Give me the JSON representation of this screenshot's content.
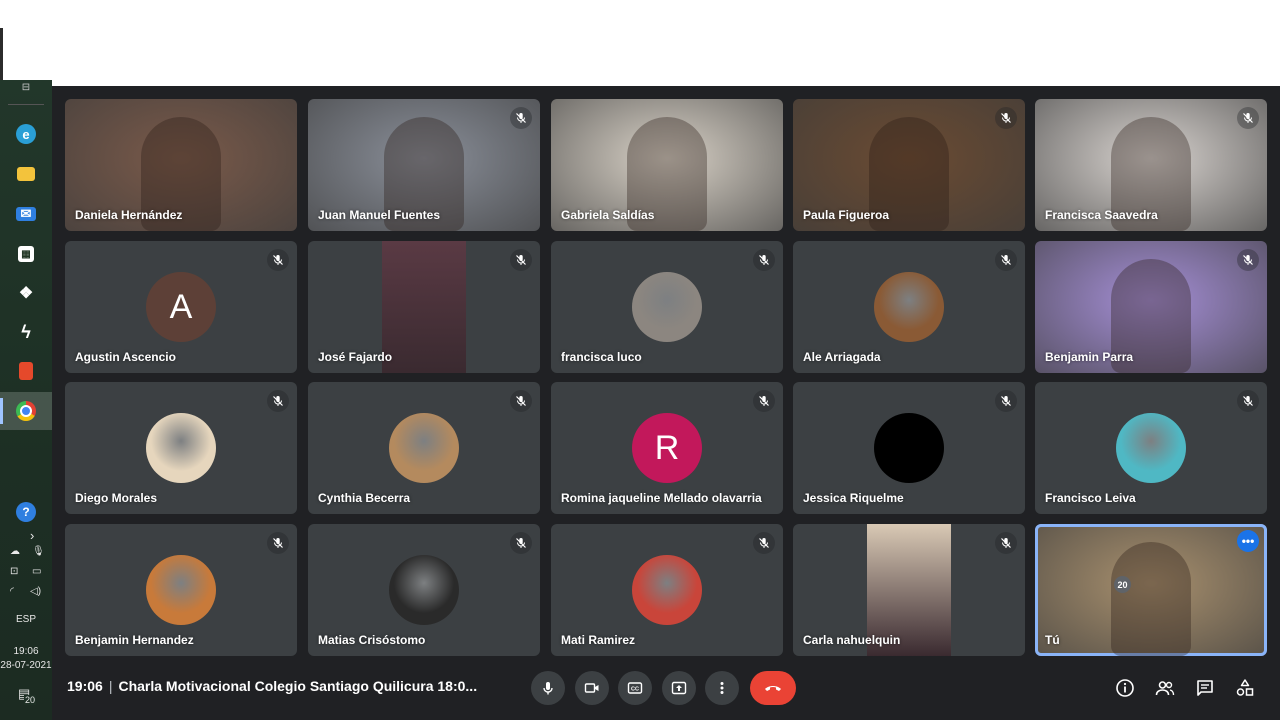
{
  "taskbar": {
    "language": "ESP",
    "time": "19:06",
    "date": "28-07-2021",
    "notifications": "20",
    "apps": [
      {
        "icon": "edge-icon",
        "color": "#2a9fd6"
      },
      {
        "icon": "file-explorer-icon",
        "color": "#f3c33c"
      },
      {
        "icon": "mail-icon",
        "color": "#2f7fe0"
      },
      {
        "icon": "store-icon",
        "color": "#ffffff"
      },
      {
        "icon": "dropbox-icon",
        "color": "#ffffff"
      },
      {
        "icon": "app-icon",
        "color": "#ffffff"
      },
      {
        "icon": "office-icon",
        "color": "#e5492b"
      },
      {
        "icon": "chrome-icon",
        "color": "#e34133"
      }
    ]
  },
  "participants": [
    {
      "name": "Daniela Hernández",
      "muted": false,
      "type": "video",
      "bg": "#7a5a4a"
    },
    {
      "name": "Juan Manuel Fuentes",
      "muted": true,
      "type": "video",
      "bg": "#8a8f99"
    },
    {
      "name": "Gabriela Saldías",
      "muted": false,
      "type": "video",
      "bg": "#d9d2c7"
    },
    {
      "name": "Paula Figueroa",
      "muted": true,
      "type": "video",
      "bg": "#6b4b32"
    },
    {
      "name": "Francisca Saavedra",
      "muted": true,
      "type": "video",
      "bg": "#d8d3cf"
    },
    {
      "name": "Agustin Ascencio",
      "muted": true,
      "type": "letter",
      "letter": "A",
      "bg": "#5d4037"
    },
    {
      "name": "José Fajardo",
      "muted": true,
      "type": "strip",
      "bg": "#5a3a44"
    },
    {
      "name": "francisca luco",
      "muted": true,
      "type": "photo",
      "bg": "#8c8680"
    },
    {
      "name": "Ale Arriagada",
      "muted": true,
      "type": "photo",
      "bg": "#8a5a35"
    },
    {
      "name": "Benjamin Parra",
      "muted": true,
      "type": "video",
      "bg": "#a58fd6"
    },
    {
      "name": "Diego Morales",
      "muted": true,
      "type": "photo",
      "bg": "#e6d6bd"
    },
    {
      "name": "Cynthia Becerra",
      "muted": true,
      "type": "photo",
      "bg": "#b48a5e"
    },
    {
      "name": "Romina jaqueline Mellado olavarria",
      "muted": true,
      "type": "letter",
      "letter": "R",
      "bg": "#c2185b"
    },
    {
      "name": "Jessica Riquelme",
      "muted": true,
      "type": "photo",
      "bg": "#000000"
    },
    {
      "name": "Francisco Leiva",
      "muted": true,
      "type": "photo",
      "bg": "#4fb8c4"
    },
    {
      "name": "Benjamin Hernandez",
      "muted": true,
      "type": "photo",
      "bg": "#c87a3a"
    },
    {
      "name": "Matias Crisóstomo",
      "muted": true,
      "type": "photo",
      "bg": "#2a2a2a"
    },
    {
      "name": "Mati Ramirez",
      "muted": true,
      "type": "photo",
      "bg": "#c9453a"
    },
    {
      "name": "Carla nahuelquin",
      "muted": true,
      "type": "strip",
      "bg": "#d9c9b5"
    },
    {
      "name": "Tú",
      "muted": false,
      "type": "self",
      "bg": "#a8906e"
    }
  ],
  "bottombar": {
    "time": "19:06",
    "meeting_title": "Charla Motivacional Colegio Santiago Quilicura 18:0...",
    "participants_count": "20"
  }
}
